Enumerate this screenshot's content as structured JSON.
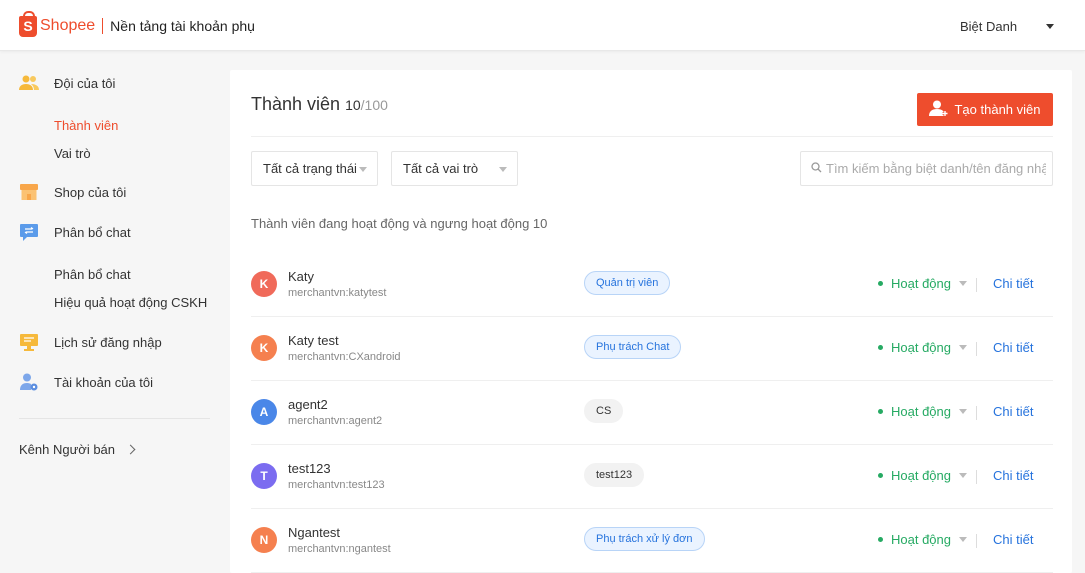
{
  "header": {
    "logo_letter": "S",
    "brand": "Shopee",
    "title": "Nền tảng tài khoản phụ",
    "nickname": "Biệt Danh"
  },
  "sidebar": {
    "team": "Đội của tôi",
    "team_sub": [
      "Thành viên",
      "Vai trò"
    ],
    "shop": "Shop của tôi",
    "chat": "Phân bổ chat",
    "chat_sub": [
      "Phân bổ chat",
      "Hiệu quả hoạt động CSKH"
    ],
    "login_history": "Lịch sử đăng nhập",
    "my_account": "Tài khoản của tôi",
    "seller_channel": "Kênh Người bán"
  },
  "main": {
    "title": "Thành viên",
    "count": "10",
    "max": "/100",
    "create_label": "Tạo thành viên",
    "status_filter": "Tất cả trạng thái",
    "role_filter": "Tất cả vai trò",
    "search_placeholder": "Tìm kiếm bằng biệt danh/tên đăng nhập",
    "summary": "Thành viên đang hoạt động và ngưng hoạt động 10",
    "detail_label": "Chi tiết",
    "members": [
      {
        "initial": "K",
        "name": "Katy",
        "login": "merchantvn:katytest",
        "role": "Quản trị viên",
        "status": "Hoạt động"
      },
      {
        "initial": "K",
        "name": "Katy test",
        "login": "merchantvn:CXandroid",
        "role": "Phụ trách Chat",
        "status": "Hoạt động"
      },
      {
        "initial": "A",
        "name": "agent2",
        "login": "merchantvn:agent2",
        "role": "CS",
        "status": "Hoạt động"
      },
      {
        "initial": "T",
        "name": "test123",
        "login": "merchantvn:test123",
        "role": "test123",
        "status": "Hoạt động"
      },
      {
        "initial": "N",
        "name": "Ngantest",
        "login": "merchantvn:ngantest",
        "role": "Phụ trách xử lý đơn",
        "status": "Hoạt động"
      }
    ]
  },
  "colors": {
    "brand": "#ee4d2d",
    "active_green": "#26aa63",
    "link_blue": "#2673dd",
    "avatar_k": "#f06a5a",
    "avatar_k2": "#f5804f",
    "avatar_a": "#4a87e8",
    "avatar_t": "#7b6cf0",
    "avatar_n": "#f5804f"
  }
}
